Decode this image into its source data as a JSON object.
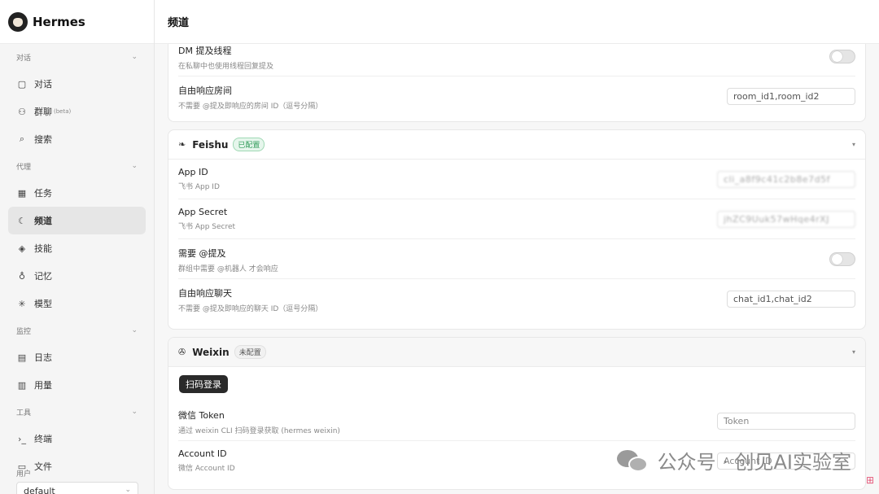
{
  "app": {
    "name": "Hermes"
  },
  "sidebar": {
    "sections": [
      {
        "label": "对话",
        "items": [
          {
            "icon": "chat-icon",
            "glyph": "▢",
            "label": "对话"
          },
          {
            "icon": "group-icon",
            "glyph": "⚇",
            "label": "群聊",
            "beta": "(beta)"
          },
          {
            "icon": "search-icon",
            "glyph": "⌕",
            "label": "搜索"
          }
        ]
      },
      {
        "label": "代理",
        "items": [
          {
            "icon": "calendar-icon",
            "glyph": "▦",
            "label": "任务"
          },
          {
            "icon": "moon-icon",
            "glyph": "☾",
            "label": "频道",
            "active": true
          },
          {
            "icon": "layers-icon",
            "glyph": "◈",
            "label": "技能"
          },
          {
            "icon": "bulb-icon",
            "glyph": "♁",
            "label": "记忆"
          },
          {
            "icon": "sun-icon",
            "glyph": "✳",
            "label": "模型"
          }
        ]
      },
      {
        "label": "监控",
        "items": [
          {
            "icon": "document-icon",
            "glyph": "▤",
            "label": "日志"
          },
          {
            "icon": "bar-chart-icon",
            "glyph": "▥",
            "label": "用量"
          }
        ]
      },
      {
        "label": "工具",
        "items": [
          {
            "icon": "terminal-icon",
            "glyph": "›_",
            "label": "终端"
          },
          {
            "icon": "folder-icon",
            "glyph": "▭",
            "label": "文件"
          }
        ]
      }
    ],
    "user_label": "用户",
    "user_value": "default"
  },
  "header": {
    "title": "频道"
  },
  "top_card": {
    "rows": [
      {
        "label": "DM 提及线程",
        "desc": "在私聊中也使用线程回复提及",
        "toggle": false
      },
      {
        "label": "自由响应房间",
        "desc": "不需要 @提及即响应的房间 ID（逗号分隔）",
        "placeholder": "room_id1,room_id2"
      }
    ]
  },
  "feishu": {
    "name": "Feishu",
    "badge": "已配置",
    "rows": [
      {
        "label": "App ID",
        "desc": "飞书 App ID",
        "value": "cli_a8f9c41c2b8e7d5f"
      },
      {
        "label": "App Secret",
        "desc": "飞书 App Secret",
        "value": "jhZC9Uuk57wHqe4rXJ"
      },
      {
        "label": "需要 @提及",
        "desc": "群组中需要 @机器人 才会响应",
        "toggle": false
      },
      {
        "label": "自由响应聊天",
        "desc": "不需要 @提及即响应的聊天 ID（逗号分隔）",
        "placeholder": "chat_id1,chat_id2"
      }
    ]
  },
  "weixin": {
    "name": "Weixin",
    "badge": "未配置",
    "scan_button": "扫码登录",
    "rows": [
      {
        "label": "微信 Token",
        "desc": "通过 weixin CLI 扫码登录获取 (hermes weixin)",
        "placeholder": "Token"
      },
      {
        "label": "Account ID",
        "desc": "微信 Account ID",
        "placeholder": "Account ID"
      }
    ]
  },
  "watermark": {
    "text": "公众号 · 创见AI实验室"
  }
}
